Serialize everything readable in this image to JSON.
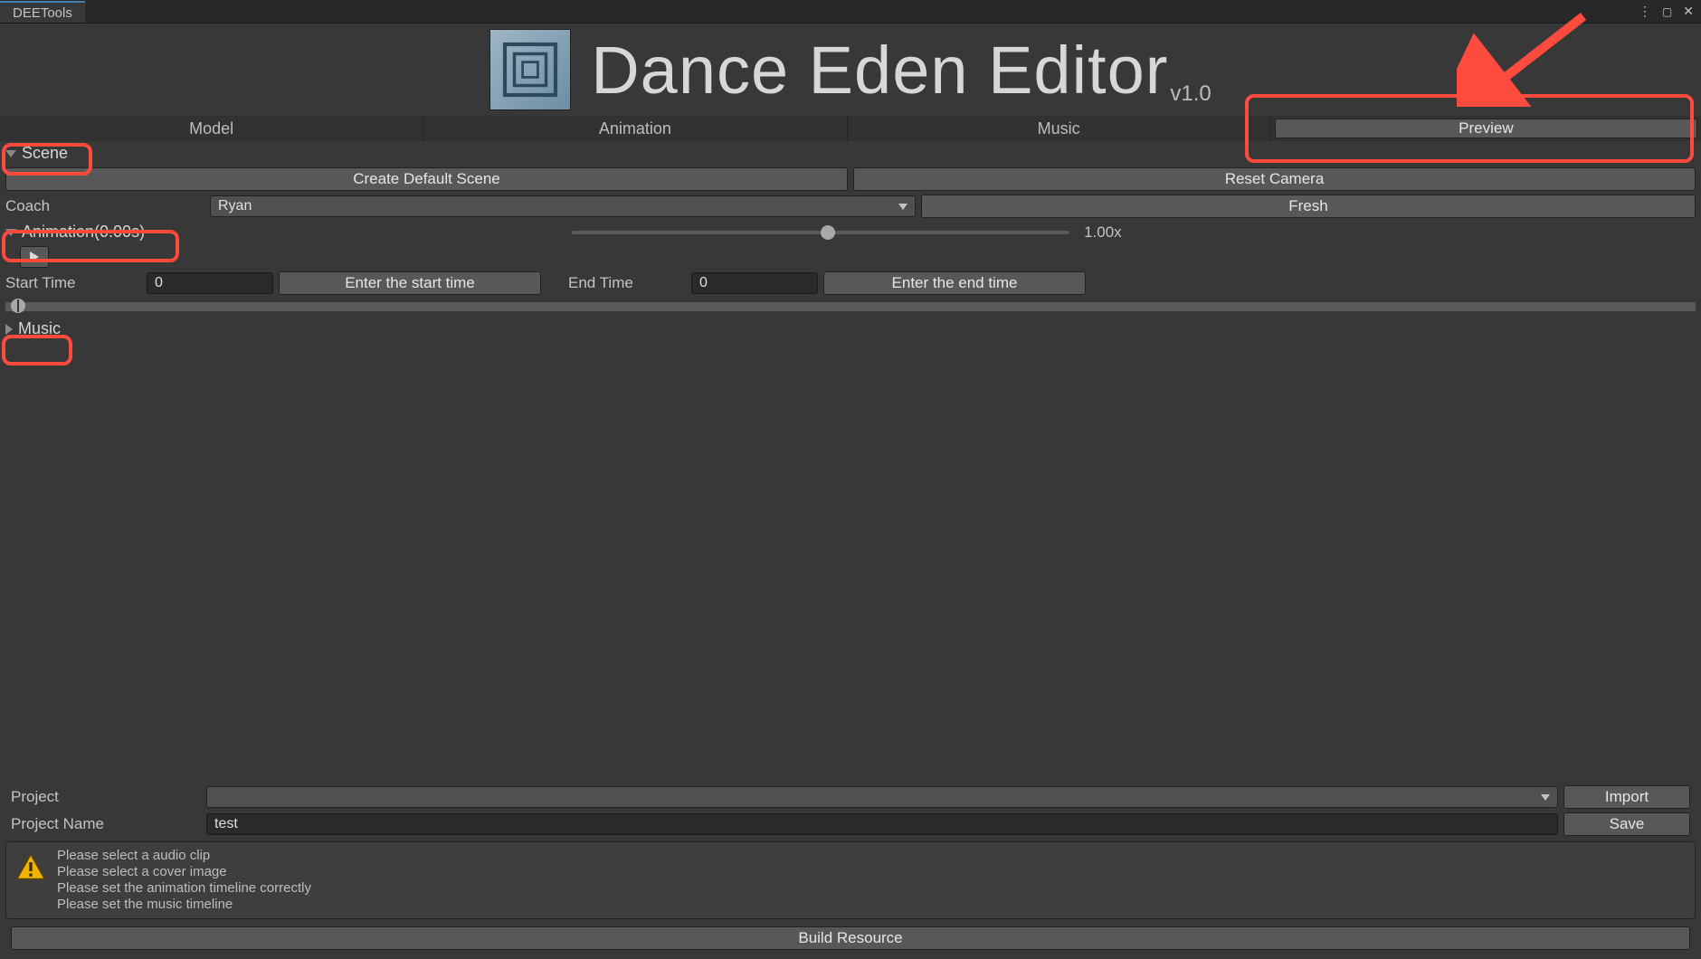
{
  "window": {
    "tab": "DEETools"
  },
  "header": {
    "title": "Dance Eden Editor",
    "version": "v1.0"
  },
  "tabs": {
    "model": "Model",
    "animation": "Animation",
    "music": "Music",
    "preview": "Preview"
  },
  "scene": {
    "label": "Scene",
    "create_btn": "Create Default Scene",
    "reset_btn": "Reset Camera",
    "coach_label": "Coach",
    "coach_value": "Ryan",
    "fresh_btn": "Fresh"
  },
  "animation": {
    "label": "Animation(0.00s)",
    "speed_label": "1.00x",
    "start_time_label": "Start Time",
    "start_time_value": "0",
    "start_time_btn": "Enter the start time",
    "end_time_label": "End Time",
    "end_time_value": "0",
    "end_time_btn": "Enter the end time"
  },
  "music": {
    "label": "Music"
  },
  "project": {
    "label": "Project",
    "dropdown_value": "",
    "import_btn": "Import",
    "name_label": "Project Name",
    "name_value": "test",
    "save_btn": "Save",
    "warnings": [
      "Please select a audio clip",
      "Please select a cover image",
      "Please set the animation timeline correctly",
      "Please set the music timeline"
    ],
    "build_btn": "Build Resource"
  }
}
